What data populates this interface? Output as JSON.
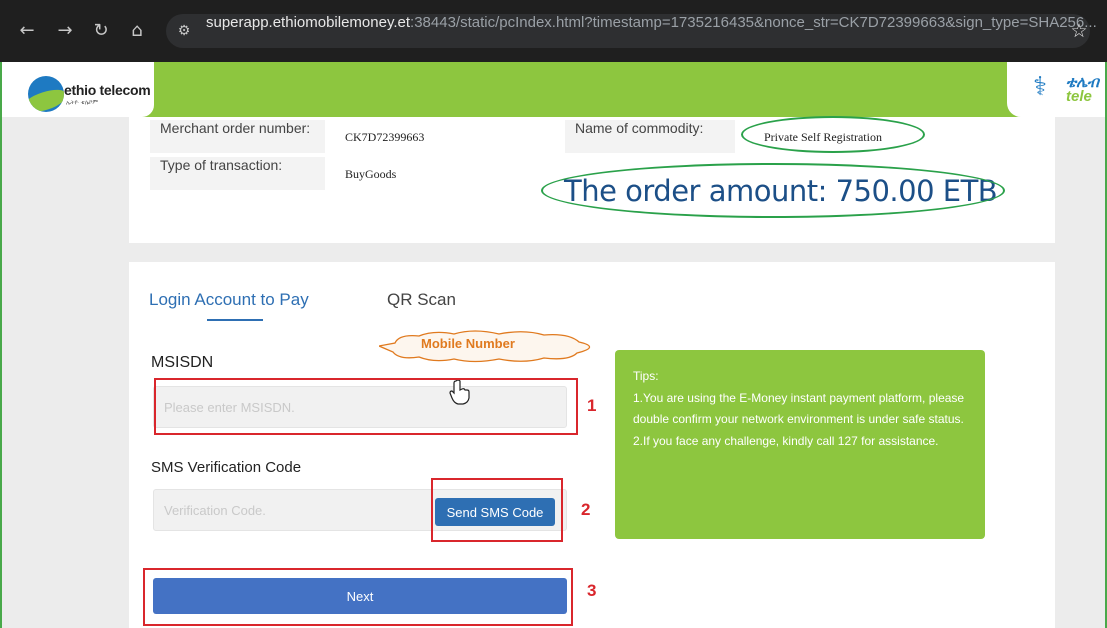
{
  "browser": {
    "url_host": "superapp.ethiomobilemoney.et",
    "url_rest": ":38443/static/pcIndex.html?timestamp=1735216435&nonce_str=CK7D72399663&sign_type=SHA256...",
    "icons": [
      "back-icon",
      "forward-icon",
      "reload-icon",
      "home-icon",
      "site-info-icon",
      "bookmark-star-icon"
    ]
  },
  "header": {
    "logo_text": "ethio telecom",
    "logo_sub": "ኢትዮ ቴሌኮም",
    "logo_right_line1": "ቴሌብ",
    "logo_right_line2": "tele"
  },
  "order": {
    "merchant_order_label": "Merchant order number:",
    "merchant_order_value": "CK7D72399663",
    "commodity_label": "Name of commodity:",
    "commodity_value": "Private Self Registration",
    "transaction_label": "Type of transaction:",
    "transaction_value": "BuyGoods",
    "amount_text": "The order amount: 750.00 ETB"
  },
  "payment": {
    "tabs": [
      {
        "label": "Login Account to Pay",
        "active": true
      },
      {
        "label": "QR Scan",
        "active": false
      }
    ],
    "msisdn_label": "MSISDN",
    "msisdn_placeholder": "Please enter MSISDN.",
    "msisdn_value": "",
    "sms_label": "SMS Verification Code",
    "sms_placeholder": "Verification Code.",
    "sms_value": "",
    "send_sms_button": "Send SMS Code",
    "next_button": "Next"
  },
  "tips": {
    "title": "Tips:",
    "line1": "1.You are using the E-Money instant payment platform, please double confirm your network environment is under safe status.",
    "line2": "2.If you face any challenge, kindly call 127 for assistance."
  },
  "annotations": {
    "cloud_label": "Mobile Number",
    "step1": "1",
    "step2": "2",
    "step3": "3",
    "colors": {
      "red": "#d9262c",
      "green": "#2aa14a",
      "orange": "#e07a1f"
    }
  },
  "colors": {
    "brand_green": "#8dc63f",
    "brand_blue": "#2e6fb3",
    "next_button": "#4472c4",
    "amount_text": "#1c4f87"
  }
}
